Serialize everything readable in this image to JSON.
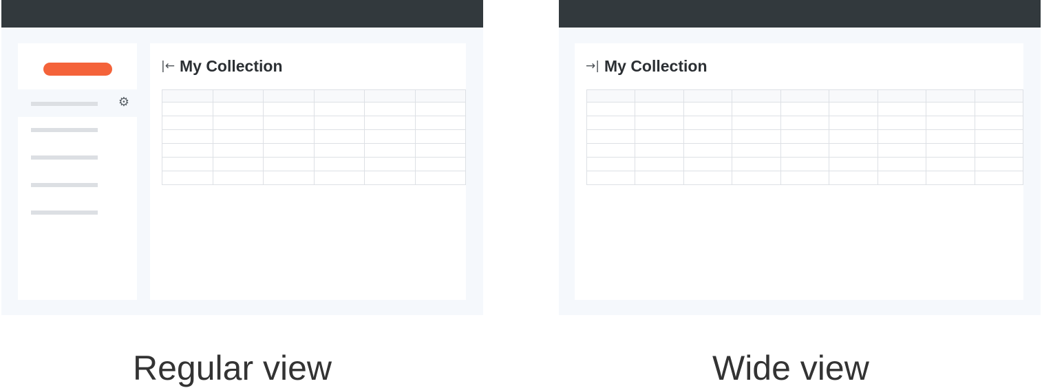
{
  "panels": [
    {
      "title": "My Collection",
      "toggle_icon": "|←",
      "caption": "Regular view"
    },
    {
      "title": "My Collection",
      "toggle_icon": "→|",
      "caption": "Wide view"
    }
  ],
  "colors": {
    "topbar": "#32393d",
    "page_background": "#f5f8fc",
    "accent_pill": "#f4633a",
    "placeholder_bar": "#dcdfe3",
    "grid_line": "#dde0e5"
  }
}
